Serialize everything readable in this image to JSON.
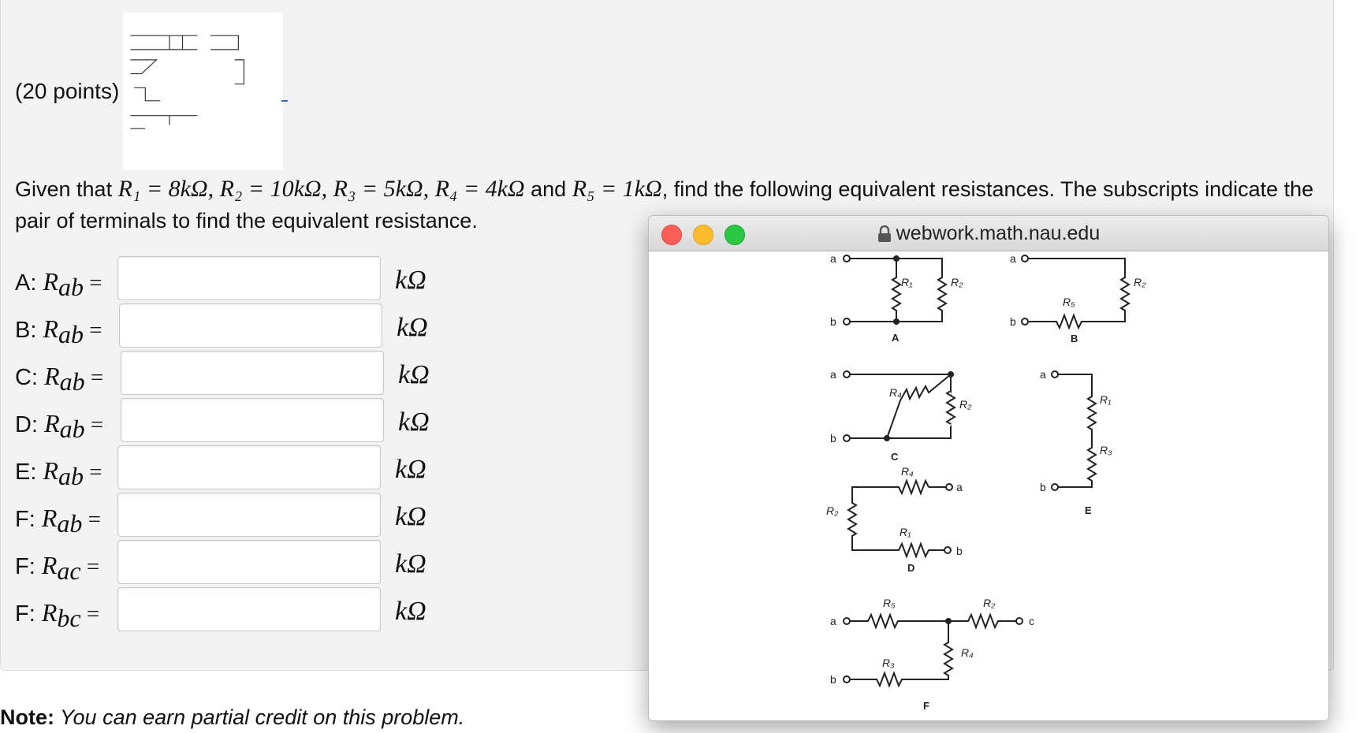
{
  "problem": {
    "points": "(20 points)",
    "given_prefix": "Given that ",
    "given_values": "R₁ = 8kΩ, R₂ = 10kΩ, R₃ = 5kΩ, R₄ = 4kΩ",
    "given_and": " and ",
    "given_r5": "R₅ = 1kΩ",
    "given_suffix": ", find the following equivalent resistances. The subscripts indicate the pair of terminals to find the equivalent resistance.",
    "rows": [
      {
        "prefix": "A: ",
        "sub": "ab",
        "unit": "kΩ",
        "value": ""
      },
      {
        "prefix": "B: ",
        "sub": "ab",
        "unit": "kΩ",
        "value": ""
      },
      {
        "prefix": "C: ",
        "sub": "ab",
        "unit": "kΩ",
        "value": ""
      },
      {
        "prefix": "D: ",
        "sub": "ab",
        "unit": "kΩ",
        "value": ""
      },
      {
        "prefix": "E: ",
        "sub": "ab",
        "unit": "kΩ",
        "value": ""
      },
      {
        "prefix": "F: ",
        "sub": "ab",
        "unit": "kΩ",
        "value": ""
      },
      {
        "prefix": "F: ",
        "sub": "ac",
        "unit": "kΩ",
        "value": ""
      },
      {
        "prefix": "F: ",
        "sub": "bc",
        "unit": "kΩ",
        "value": ""
      }
    ],
    "note_bold": "Note:",
    "note_text": " You can earn partial credit on this problem."
  },
  "popup": {
    "url": "webwork.math.nau.edu",
    "traffic_lights": {
      "close": "#fc5f57",
      "minimize": "#fdbc2e",
      "maximize": "#28c840"
    },
    "labels": {
      "a": "a",
      "b": "b",
      "c": "c",
      "R1": "R₁",
      "R2": "R₂",
      "R3": "R₃",
      "R4": "R₄",
      "R5": "R₅",
      "A": "A",
      "B": "B",
      "C": "C",
      "D": "D",
      "E": "E",
      "F": "F"
    }
  }
}
